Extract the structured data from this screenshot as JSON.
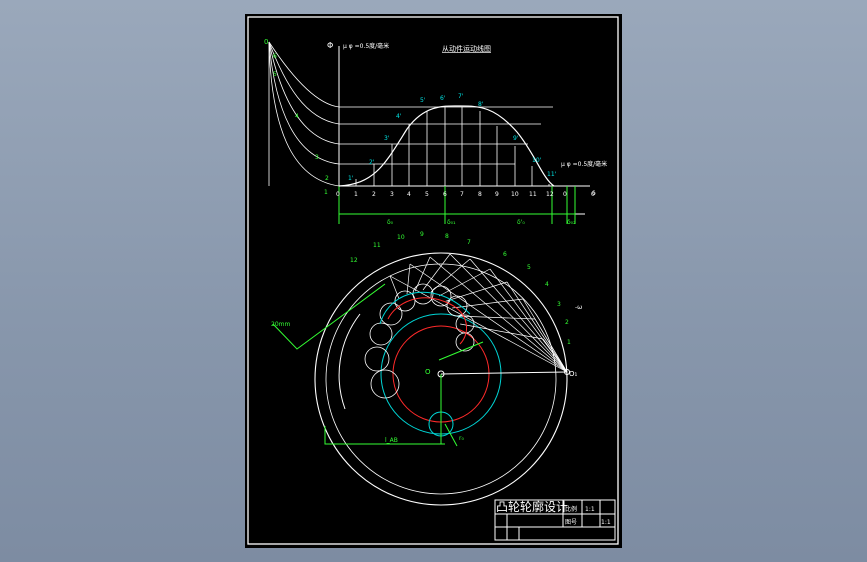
{
  "drawing": {
    "title_block": {
      "title": "凸轮轮廓设计",
      "cells": [
        "比例",
        "1:1",
        "图号",
        "1:1"
      ]
    },
    "graph_title": "从动件运动线图",
    "scale_top": "μ φ =0.5度/毫米",
    "scale_right": "μ φ =0.5度/毫米",
    "axis_symbol": "Φ",
    "axis_end": "δ",
    "x_ticks": [
      "0",
      "1",
      "2",
      "3",
      "4",
      "5",
      "6",
      "7",
      "8",
      "9",
      "10",
      "11",
      "12",
      "0",
      "0"
    ],
    "curve_labels": [
      "1'",
      "2'",
      "3'",
      "4'",
      "5'",
      "6'",
      "7'",
      "8'",
      "9'",
      "10'",
      "11'",
      "12'"
    ],
    "left_labels": [
      "6",
      "5",
      "4",
      "3",
      "2",
      "1"
    ],
    "phase_labels": [
      "δ₀",
      "δ₀₁",
      "δ'₀",
      "δ₀₂"
    ],
    "circle_labels": [
      "12",
      "11",
      "10",
      "9",
      "8",
      "7",
      "6",
      "5",
      "4",
      "3",
      "2",
      "1"
    ],
    "scale_bar_left": "20mm",
    "label_lab": "l_AB",
    "label_o": "O",
    "label_o2": "O₁",
    "label_r0": "r₀",
    "label_omega": "-ω"
  },
  "colors": {
    "background": "#000000",
    "lines": "#ffffff",
    "labels": "#33ff33",
    "circle_red": "#ff2a2a",
    "circle_cyan": "#00d5d5"
  }
}
